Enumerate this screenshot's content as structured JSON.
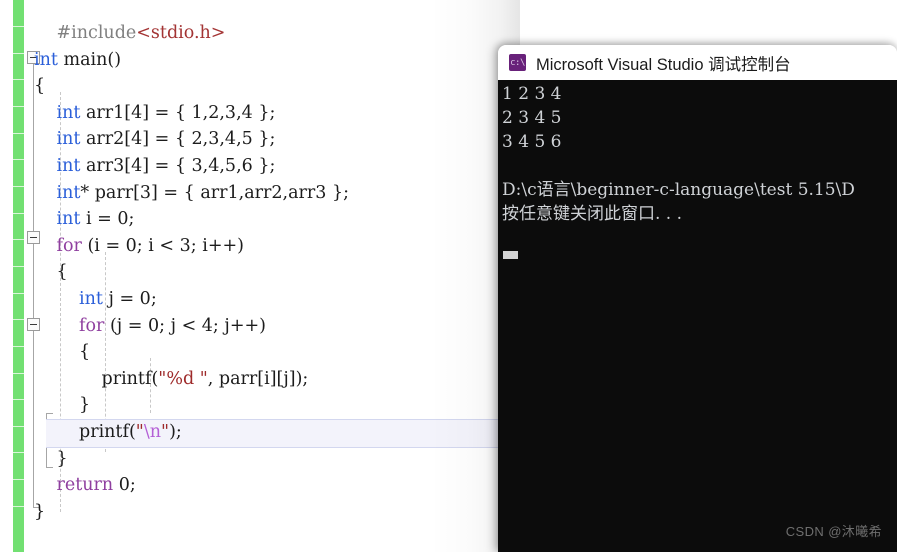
{
  "editor": {
    "name": "visual-studio-code-editor",
    "language": "C",
    "code_lines": [
      {
        "indent": 1,
        "tokens": [
          {
            "t": "#include",
            "c": "k-pre"
          },
          {
            "t": "<stdio.h>",
            "c": "k-inc"
          }
        ]
      },
      {
        "indent": 0,
        "tokens": [
          {
            "t": "int",
            "c": "k-type"
          },
          {
            "t": " main()",
            "c": "k-plain"
          }
        ]
      },
      {
        "indent": 0,
        "tokens": [
          {
            "t": "{",
            "c": "k-plain"
          }
        ]
      },
      {
        "indent": 1,
        "tokens": [
          {
            "t": "int",
            "c": "k-type"
          },
          {
            "t": " arr1[4] = { 1,2,3,4 };",
            "c": "k-plain"
          }
        ]
      },
      {
        "indent": 1,
        "tokens": [
          {
            "t": "int",
            "c": "k-type"
          },
          {
            "t": " arr2[4] = { 2,3,4,5 };",
            "c": "k-plain"
          }
        ]
      },
      {
        "indent": 1,
        "tokens": [
          {
            "t": "int",
            "c": "k-type"
          },
          {
            "t": " arr3[4] = { 3,4,5,6 };",
            "c": "k-plain"
          }
        ]
      },
      {
        "indent": 1,
        "tokens": [
          {
            "t": "int",
            "c": "k-type"
          },
          {
            "t": "* parr[3] = { arr1,arr2,arr3 };",
            "c": "k-plain"
          }
        ]
      },
      {
        "indent": 1,
        "tokens": [
          {
            "t": "int",
            "c": "k-type"
          },
          {
            "t": " i = 0;",
            "c": "k-plain"
          }
        ]
      },
      {
        "indent": 1,
        "tokens": [
          {
            "t": "for",
            "c": "k-ctrl"
          },
          {
            "t": " (i = 0; i < 3; i++)",
            "c": "k-plain"
          }
        ]
      },
      {
        "indent": 1,
        "tokens": [
          {
            "t": "{",
            "c": "k-plain"
          }
        ]
      },
      {
        "indent": 2,
        "tokens": [
          {
            "t": "int",
            "c": "k-type"
          },
          {
            "t": " j = 0;",
            "c": "k-plain"
          }
        ]
      },
      {
        "indent": 2,
        "tokens": [
          {
            "t": "for",
            "c": "k-ctrl"
          },
          {
            "t": " (j = 0; j < 4; j++)",
            "c": "k-plain"
          }
        ]
      },
      {
        "indent": 2,
        "tokens": [
          {
            "t": "{",
            "c": "k-plain"
          }
        ]
      },
      {
        "indent": 3,
        "tokens": [
          {
            "t": "printf(",
            "c": "k-plain"
          },
          {
            "t": "\"%d \"",
            "c": "k-str"
          },
          {
            "t": ", parr[i][j]);",
            "c": "k-plain"
          }
        ]
      },
      {
        "indent": 2,
        "tokens": [
          {
            "t": "}",
            "c": "k-plain"
          }
        ]
      },
      {
        "indent": 2,
        "tokens": [
          {
            "t": "printf(",
            "c": "k-plain"
          },
          {
            "t": "\"",
            "c": "k-str"
          },
          {
            "t": "\\n",
            "c": "k-esc"
          },
          {
            "t": "\"",
            "c": "k-str"
          },
          {
            "t": ");",
            "c": "k-plain"
          }
        ]
      },
      {
        "indent": 1,
        "tokens": [
          {
            "t": "}",
            "c": "k-plain"
          }
        ]
      },
      {
        "indent": 1,
        "tokens": [
          {
            "t": "return",
            "c": "k-ctrl"
          },
          {
            "t": " 0;",
            "c": "k-plain"
          }
        ]
      },
      {
        "indent": 0,
        "tokens": [
          {
            "t": "}",
            "c": "k-plain"
          }
        ]
      }
    ],
    "current_line_index": 15,
    "fold_markers": [
      {
        "line": 1
      },
      {
        "line": 8
      },
      {
        "line": 11
      }
    ],
    "change_bar_color": "#72e072"
  },
  "console": {
    "icon": "visual-studio-debug-console-icon",
    "icon_glyph": "c:\\",
    "title": "Microsoft Visual Studio 调试控制台",
    "output_lines": [
      "1 2 3 4 ",
      "2 3 4 5 ",
      "3 4 5 6 ",
      "",
      "D:\\c语言\\beginner-c-language\\test 5.15\\D",
      "按任意键关闭此窗口. . ."
    ],
    "background_color": "#0c0c0c",
    "text_color": "#cfd2d6"
  },
  "watermark": {
    "text": "CSDN @沐曦希"
  }
}
